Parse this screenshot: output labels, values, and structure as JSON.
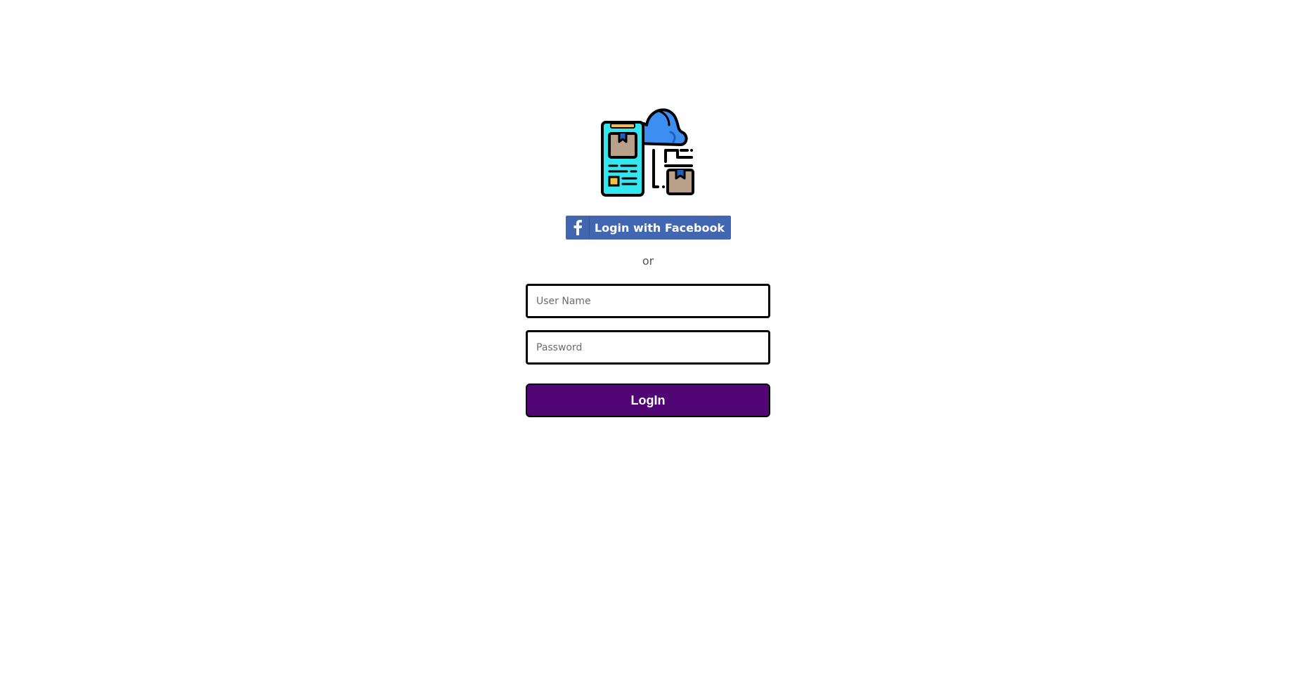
{
  "logo": {
    "icon": "logistics-app-icon"
  },
  "facebook_button": {
    "label": "Login with Facebook",
    "icon": "facebook-icon",
    "color": "#4267b2"
  },
  "separator": {
    "text": "or"
  },
  "username_input": {
    "placeholder": "User Name",
    "value": ""
  },
  "password_input": {
    "placeholder": "Password",
    "value": ""
  },
  "login_button": {
    "label": "LogIn",
    "color": "#520575"
  }
}
